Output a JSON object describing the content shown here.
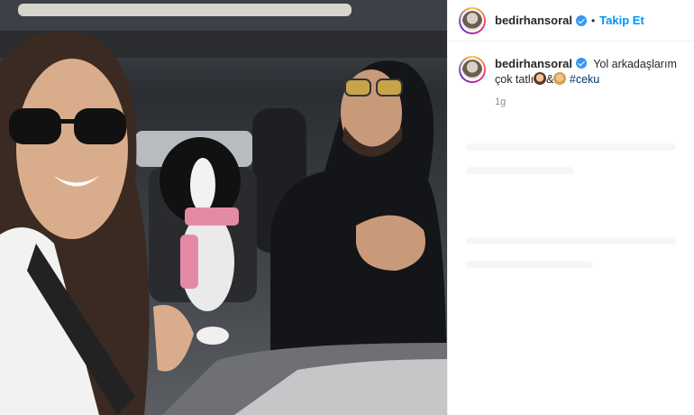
{
  "post": {
    "username": "bedirhansoral",
    "separator": "•",
    "follow_label": "Takip Et"
  },
  "caption": {
    "username": "bedirhansoral",
    "text": "Yol arkadaşlarım çok tatlı",
    "amp": "&",
    "hashtag": "#ceku",
    "time": "1g"
  },
  "icons": [
    "verified-badge-icon",
    "avatar",
    "emoji-woman-icon",
    "emoji-man-icon"
  ],
  "colors": {
    "accent": "#0095f6",
    "verified": "#3897f0",
    "hashtag": "#00376b",
    "muted": "#8e8e8e"
  }
}
